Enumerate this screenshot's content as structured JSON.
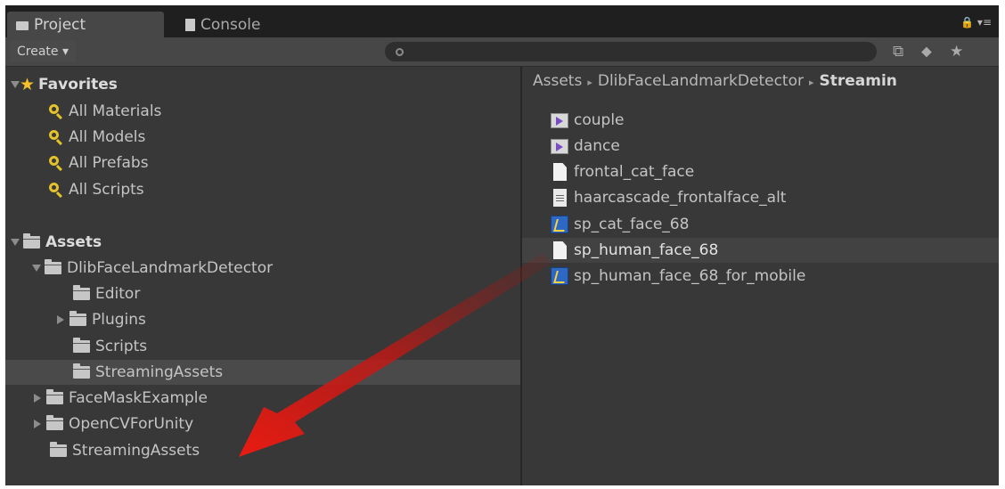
{
  "tabs": [
    {
      "label": "Project",
      "active": true,
      "icon": "folder-icon"
    },
    {
      "label": "Console",
      "active": false,
      "icon": "console-icon"
    }
  ],
  "toolbar": {
    "create_label": "Create ▾",
    "search_value": "",
    "icons": [
      "filter-by-type-icon",
      "filter-by-label-icon",
      "star-icon"
    ]
  },
  "tree": {
    "favorites": {
      "label": "Favorites",
      "items": [
        "All Materials",
        "All Models",
        "All Prefabs",
        "All Scripts"
      ]
    },
    "assets": {
      "label": "Assets",
      "dlib": "DlibFaceLandmarkDetector",
      "dlib_children": [
        "Editor",
        "Plugins",
        "Scripts",
        "StreamingAssets"
      ],
      "others": [
        "FaceMaskExample",
        "OpenCVForUnity",
        "StreamingAssets"
      ]
    }
  },
  "breadcrumb": {
    "items": [
      "Assets",
      "DlibFaceLandmarkDetector"
    ],
    "current": "Streamin",
    "separator": "▸"
  },
  "files": [
    {
      "name": "couple",
      "icon": "video-icon"
    },
    {
      "name": "dance",
      "icon": "video-icon"
    },
    {
      "name": "frontal_cat_face",
      "icon": "document-icon"
    },
    {
      "name": "haarcascade_frontalface_alt",
      "icon": "text-file-icon"
    },
    {
      "name": "sp_cat_face_68",
      "icon": "binary-file-icon"
    },
    {
      "name": "sp_human_face_68",
      "icon": "document-icon",
      "selected": true
    },
    {
      "name": "sp_human_face_68_for_mobile",
      "icon": "binary-file-icon"
    }
  ],
  "annotation": {
    "arrow_color": "#e01a14"
  }
}
